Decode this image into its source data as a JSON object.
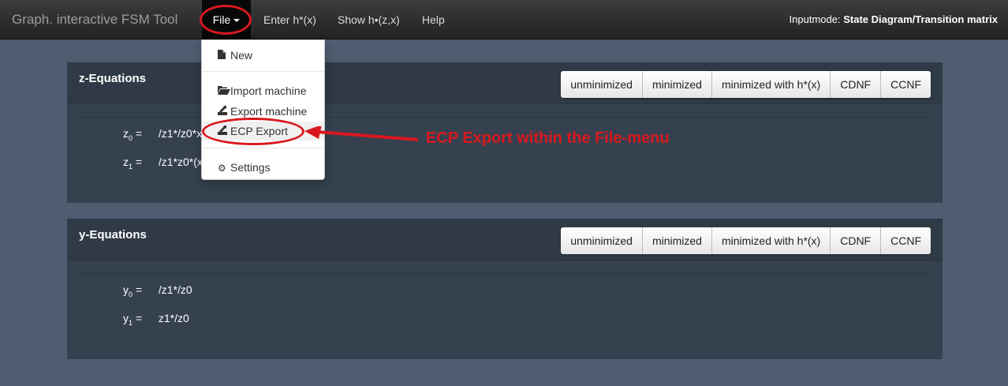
{
  "navbar": {
    "brand": "Graph. interactive FSM Tool",
    "file_label": "File",
    "enter_label": "Enter h*(x)",
    "show_label": "Show h•(z,x)",
    "help_label": "Help",
    "inputmode_label": "Inputmode:",
    "inputmode_value": "State Diagram/Transition matrix"
  },
  "file_menu": {
    "new": "New",
    "import": "Import machine",
    "export": "Export machine",
    "ecp_export": "ECP Export",
    "settings": "Settings"
  },
  "minimize_buttons": [
    "unminimized",
    "minimized",
    "minimized with h*(x)",
    "CDNF",
    "CCNF"
  ],
  "z_panel": {
    "title": "z-Equations",
    "equations": [
      {
        "var": "z",
        "index": "0",
        "eq": "=",
        "expr": "/z1*/z0*x"
      },
      {
        "var": "z",
        "index": "1",
        "eq": "=",
        "expr": "/z1*z0*(x"
      }
    ]
  },
  "y_panel": {
    "title": "y-Equations",
    "equations": [
      {
        "var": "y",
        "index": "0",
        "eq": "=",
        "expr": "/z1*/z0"
      },
      {
        "var": "y",
        "index": "1",
        "eq": "=",
        "expr": "z1*/z0"
      }
    ]
  },
  "annotation": {
    "text": "ECP Export within the File-menu",
    "color": "#d9181e"
  },
  "colors": {
    "background": "#4e5d70",
    "panel": "#35414f",
    "navbar": "#222222"
  },
  "icons": {
    "new": "file-icon",
    "import": "folder-open-icon",
    "export": "export-icon",
    "ecp_export": "export-icon",
    "settings": "gear-icon"
  }
}
